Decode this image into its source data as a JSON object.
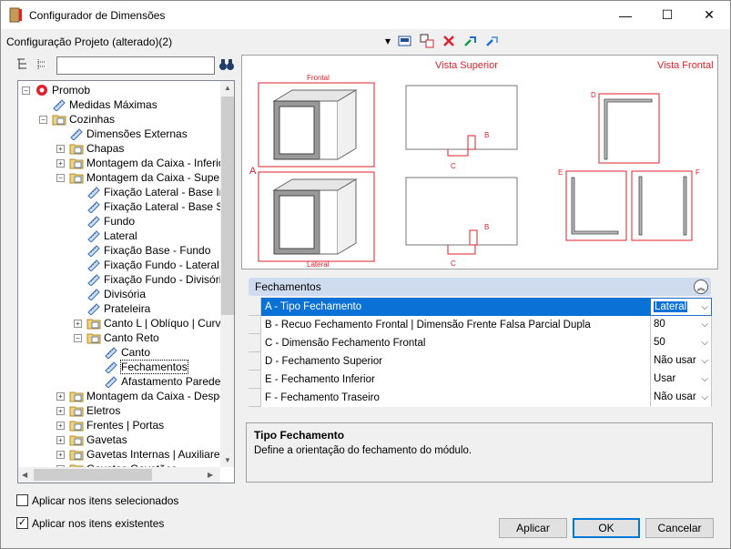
{
  "window": {
    "title": "Configurador de Dimensões",
    "minimize": "—",
    "maximize": "☐",
    "close": "✕"
  },
  "config_label": "Configuração Projeto (alterado)(2)",
  "toolbar": {
    "dropdown_arrow": "▾"
  },
  "tree": {
    "items": [
      {
        "label": "Promob",
        "level": 0,
        "expander": "-",
        "icon": "promob-logo-icon"
      },
      {
        "label": "Medidas Máximas",
        "level": 1,
        "expander": "",
        "icon": "ruler-icon"
      },
      {
        "label": "Cozinhas",
        "level": 1,
        "expander": "-",
        "icon": "folder-icon"
      },
      {
        "label": "Dimensões Externas",
        "level": 2,
        "expander": "",
        "icon": "ruler-icon"
      },
      {
        "label": "Chapas",
        "level": 2,
        "expander": "+",
        "icon": "folder-icon"
      },
      {
        "label": "Montagem da Caixa - Inferior",
        "level": 2,
        "expander": "+",
        "icon": "folder-icon"
      },
      {
        "label": "Montagem da Caixa - Superior",
        "level": 2,
        "expander": "-",
        "icon": "folder-icon"
      },
      {
        "label": "Fixação Lateral - Base Inferior",
        "level": 3,
        "expander": "",
        "icon": "ruler-icon"
      },
      {
        "label": "Fixação Lateral - Base Superior",
        "level": 3,
        "expander": "",
        "icon": "ruler-icon"
      },
      {
        "label": "Fundo",
        "level": 3,
        "expander": "",
        "icon": "ruler-icon"
      },
      {
        "label": "Lateral",
        "level": 3,
        "expander": "",
        "icon": "ruler-icon"
      },
      {
        "label": "Fixação Base - Fundo",
        "level": 3,
        "expander": "",
        "icon": "ruler-icon"
      },
      {
        "label": "Fixação Fundo - Lateral",
        "level": 3,
        "expander": "",
        "icon": "ruler-icon"
      },
      {
        "label": "Fixação Fundo - Divisória",
        "level": 3,
        "expander": "",
        "icon": "ruler-icon"
      },
      {
        "label": "Divisória",
        "level": 3,
        "expander": "",
        "icon": "ruler-icon"
      },
      {
        "label": "Prateleira",
        "level": 3,
        "expander": "",
        "icon": "ruler-icon"
      },
      {
        "label": "Canto L | Oblíquo | Curvo",
        "level": 3,
        "expander": "+",
        "icon": "folder-icon"
      },
      {
        "label": "Canto Reto",
        "level": 3,
        "expander": "-",
        "icon": "folder-icon"
      },
      {
        "label": "Canto",
        "level": 4,
        "expander": "",
        "icon": "ruler-icon"
      },
      {
        "label": "Fechamentos",
        "level": 4,
        "expander": "",
        "icon": "ruler-icon",
        "selected": true
      },
      {
        "label": "Afastamento Parede",
        "level": 4,
        "expander": "",
        "icon": "ruler-icon"
      },
      {
        "label": "Montagem da Caixa - Despenseiro",
        "level": 2,
        "expander": "+",
        "icon": "folder-icon"
      },
      {
        "label": "Eletros",
        "level": 2,
        "expander": "+",
        "icon": "folder-icon"
      },
      {
        "label": "Frentes | Portas",
        "level": 2,
        "expander": "+",
        "icon": "folder-icon"
      },
      {
        "label": "Gavetas",
        "level": 2,
        "expander": "+",
        "icon": "folder-icon"
      },
      {
        "label": "Gavetas Internas | Auxiliares",
        "level": 2,
        "expander": "+",
        "icon": "folder-icon"
      },
      {
        "label": "Gavetas Gavetões",
        "level": 2,
        "expander": "+",
        "icon": "folder-icon"
      }
    ]
  },
  "preview": {
    "view_top": "Vista Superior",
    "view_front": "Vista Frontal",
    "label_frontal": "Frontal",
    "label_lateral": "Lateral",
    "label_a": "A",
    "label_b": "B",
    "label_c": "C",
    "label_d": "D",
    "label_e": "E",
    "label_f": "F"
  },
  "section": {
    "title": "Fechamentos",
    "collapse": "︽"
  },
  "properties": [
    {
      "name": "A - Tipo Fechamento",
      "value": "Lateral",
      "selected": true
    },
    {
      "name": "B - Recuo Fechamento Frontal | Dimensão Frente Falsa Parcial Dupla",
      "value": "80"
    },
    {
      "name": "C - Dimensão Fechamento Frontal",
      "value": "50"
    },
    {
      "name": "D - Fechamento Superior",
      "value": "Não usar"
    },
    {
      "name": "E - Fechamento Inferior",
      "value": "Usar"
    },
    {
      "name": "F - Fechamento Traseiro",
      "value": "Não usar"
    }
  ],
  "description": {
    "title": "Tipo Fechamento",
    "text": "Define a orientação do fechamento do módulo."
  },
  "options": {
    "apply_selected": "Aplicar nos itens selecionados",
    "apply_selected_checked": false,
    "apply_existing": "Aplicar nos itens existentes",
    "apply_existing_checked": true
  },
  "buttons": {
    "apply": "Aplicar",
    "ok": "OK",
    "cancel": "Cancelar"
  },
  "colors": {
    "accent_red": "#e0202a",
    "selection_blue": "#0a72d6",
    "header_blue": "#cfdcf0"
  }
}
